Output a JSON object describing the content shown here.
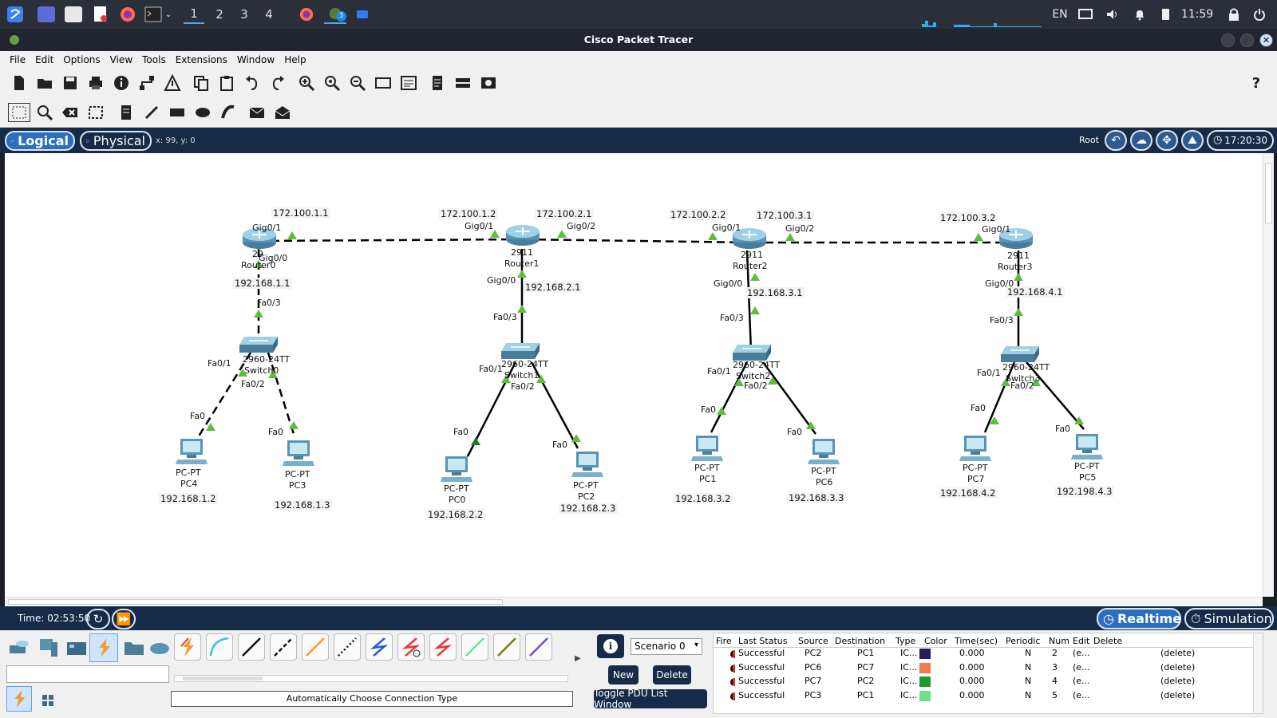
{
  "taskbar": {
    "workspaces": [
      "1",
      "2",
      "3",
      "4"
    ],
    "badge": "3",
    "lang": "EN",
    "time": "11:59"
  },
  "window": {
    "title": "Cisco Packet Tracer"
  },
  "menu": [
    "File",
    "Edit",
    "Options",
    "View",
    "Tools",
    "Extensions",
    "Window",
    "Help"
  ],
  "help_glyph": "?",
  "viewbar": {
    "logical": "Logical",
    "physical": "Physical",
    "coords": "x: 99, y: 0",
    "root": "Root",
    "clock": "17:20:30"
  },
  "topology": {
    "routers": [
      {
        "model": "29",
        "name": "Router0"
      },
      {
        "model": "2911",
        "name": "Router1"
      },
      {
        "model": "2911",
        "name": "Router2"
      },
      {
        "model": "2911",
        "name": "Router3"
      }
    ],
    "switches": [
      {
        "model": "2960-24TT",
        "name": "Switch0"
      },
      {
        "model": "2960-24TT",
        "name": "Switch1"
      },
      {
        "model": "2960-24TT",
        "name": "Switch2"
      },
      {
        "model": "2960-24TT",
        "name": "Switch3"
      }
    ],
    "pcs": [
      {
        "type": "PC-PT",
        "name": "PC4",
        "ip": "192.168.1.2"
      },
      {
        "type": "PC-PT",
        "name": "PC3",
        "ip": "192.168.1.3"
      },
      {
        "type": "PC-PT",
        "name": "PC0",
        "ip": "192.168.2.2"
      },
      {
        "type": "PC-PT",
        "name": "PC2",
        "ip": "192.168.2.3"
      },
      {
        "type": "PC-PT",
        "name": "PC1",
        "ip": "192.168.3.2"
      },
      {
        "type": "PC-PT",
        "name": "PC6",
        "ip": "192.168.3.3"
      },
      {
        "type": "PC-PT",
        "name": "PC7",
        "ip": "192.168.4.2"
      },
      {
        "type": "PC-PT",
        "name": "PC5",
        "ip": "192.198.4.3"
      }
    ],
    "wan_ips": [
      "172.100.1.1",
      "172.100.1.2",
      "172.100.2.1",
      "172.100.2.2",
      "172.100.3.1",
      "172.100.3.2"
    ],
    "lan_ips": [
      "192.168.1.1",
      "192.168.2.1",
      "192.168.3.1",
      "192.168.4.1"
    ],
    "ports": {
      "gig01": "Gig0/1",
      "gig02": "Gig0/2",
      "gig00": "Gig0/0",
      "fa03": "Fa0/3",
      "fa01": "Fa0/1",
      "fa02": "Fa0/2",
      "fa0": "Fa0"
    }
  },
  "sim": {
    "time": "Time: 02:53:50",
    "realtime": "Realtime",
    "simulation": "Simulation"
  },
  "bottom": {
    "connection_type": "Automatically Choose Connection Type",
    "scenario": "Scenario 0",
    "new": "New",
    "delete": "Delete",
    "toggle": "Toggle PDU List Window",
    "info_glyph": "i"
  },
  "pdu": {
    "headers": [
      "Fire",
      "Last Status",
      "Source",
      "Destination",
      "Type",
      "Color",
      "Time(sec)",
      "Periodic",
      "Num",
      "Edit",
      "Delete"
    ],
    "rows": [
      {
        "status": "Successful",
        "source": "PC2",
        "dest": "PC1",
        "type": "IC...",
        "color": "#2a1a5e",
        "time": "0.000",
        "periodic": "N",
        "num": "2",
        "edit": "(e...",
        "delete": "(delete)"
      },
      {
        "status": "Successful",
        "source": "PC6",
        "dest": "PC7",
        "type": "IC...",
        "color": "#f07a4a",
        "time": "0.000",
        "periodic": "N",
        "num": "3",
        "edit": "(e...",
        "delete": "(delete)"
      },
      {
        "status": "Successful",
        "source": "PC7",
        "dest": "PC2",
        "type": "IC...",
        "color": "#1f9a2e",
        "time": "0.000",
        "periodic": "N",
        "num": "4",
        "edit": "(e...",
        "delete": "(delete)"
      },
      {
        "status": "Successful",
        "source": "PC3",
        "dest": "PC1",
        "type": "IC...",
        "color": "#6ee08a",
        "time": "0.000",
        "periodic": "N",
        "num": "5",
        "edit": "(e...",
        "delete": "(delete)"
      }
    ]
  }
}
